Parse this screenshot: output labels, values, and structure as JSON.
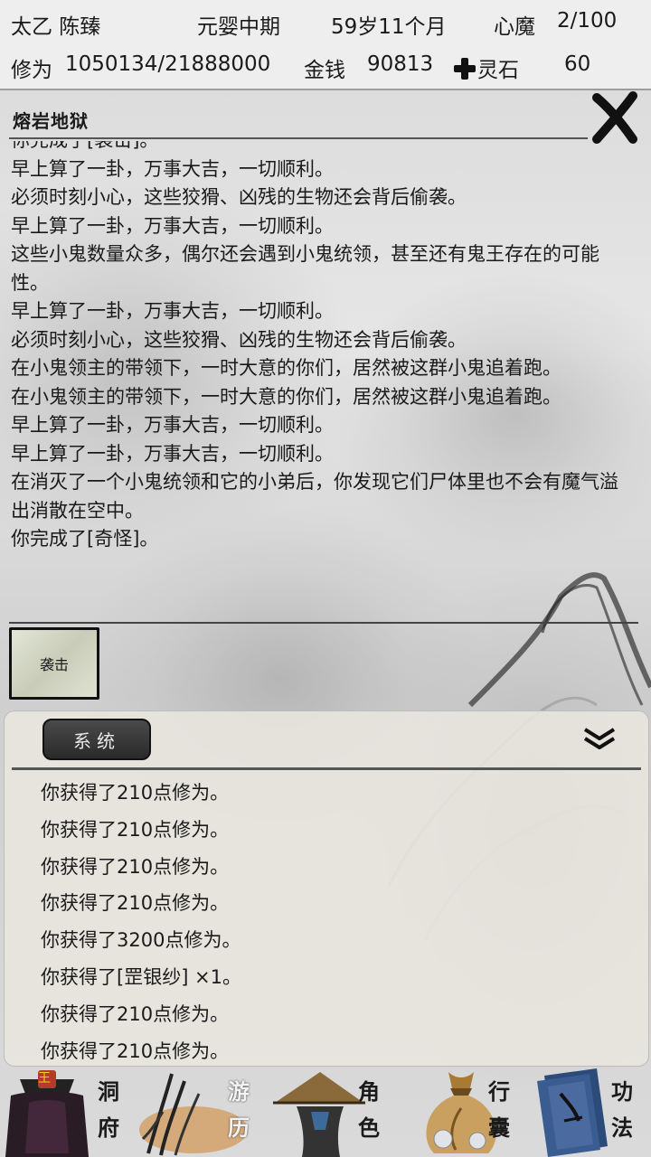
{
  "status": {
    "name": "太乙 陈臻",
    "realm": "元婴中期",
    "age": "59岁11个月",
    "heart_demon_label": "心魔",
    "heart_demon_value": "2/100",
    "cultivation_label": "修为",
    "cultivation_value": "1050134/21888000",
    "money_label": "金钱",
    "money_value": "90813",
    "spirit_stone_label": "灵石",
    "spirit_stone_value": "60"
  },
  "location": {
    "title": "熔岩地狱"
  },
  "log": {
    "lines": [
      "你完成了[袭击]。",
      "早上算了一卦，万事大吉，一切顺利。",
      "必须时刻小心，这些狡猾、凶残的生物还会背后偷袭。",
      "早上算了一卦，万事大吉，一切顺利。",
      "这些小鬼数量众多，偶尔还会遇到小鬼统领，甚至还有鬼王存在的可能性。",
      "早上算了一卦，万事大吉，一切顺利。",
      "必须时刻小心，这些狡猾、凶残的生物还会背后偷袭。",
      "在小鬼领主的带领下，一时大意的你们，居然被这群小鬼追着跑。",
      "在小鬼领主的带领下，一时大意的你们，居然被这群小鬼追着跑。",
      "早上算了一卦，万事大吉，一切顺利。",
      "早上算了一卦，万事大吉，一切顺利。",
      "在消灭了一个小鬼统领和它的小弟后，你发现它们尸体里也不会有魔气溢出消散在空中。",
      "你完成了[奇怪]。"
    ]
  },
  "action": {
    "label": "袭击"
  },
  "system": {
    "tab_label": "系统",
    "messages": [
      "你获得了210点修为。",
      "你获得了210点修为。",
      "你获得了210点修为。",
      "你获得了210点修为。",
      "你获得了3200点修为。",
      "你获得了[罡银纱] ×1。",
      "你获得了210点修为。",
      "你获得了210点修为。"
    ]
  },
  "nav": {
    "cave_1": "洞",
    "cave_2": "府",
    "travel_1": "游",
    "travel_2": "历",
    "role_1": "角",
    "role_2": "色",
    "bag_1": "行",
    "bag_2": "囊",
    "skill_1": "功",
    "skill_2": "法",
    "cave_badge": "王"
  }
}
